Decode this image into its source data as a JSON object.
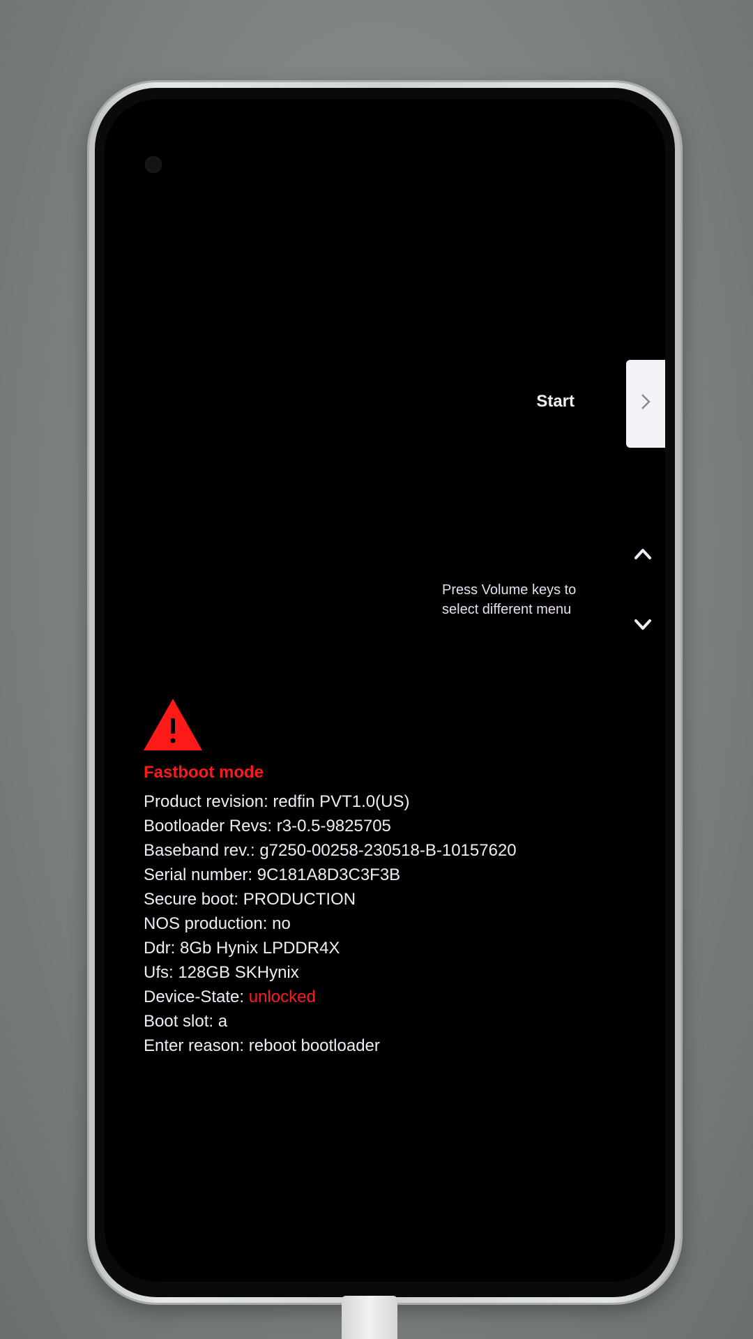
{
  "menu": {
    "start_label": "Start",
    "hint": "Press Volume keys to select different menu"
  },
  "mode": {
    "title": "Fastboot mode",
    "title_color": "#ff1a1a"
  },
  "info": {
    "product_revision": "Product revision: redfin PVT1.0(US)",
    "bootloader_revs": "Bootloader Revs: r3-0.5-9825705",
    "baseband_rev": "Baseband rev.: g7250-00258-230518-B-10157620",
    "serial_number": "Serial number: 9C181A8D3C3F3B",
    "secure_boot": "Secure boot: PRODUCTION",
    "nos_production": "NOS production: no",
    "ddr": "Ddr: 8Gb Hynix LPDDR4X",
    "ufs": "Ufs: 128GB SKHynix",
    "device_state_label": "Device-State: ",
    "device_state_value": "unlocked",
    "boot_slot": "Boot slot: a",
    "enter_reason": "Enter reason: reboot bootloader"
  },
  "icons": {
    "warning": "warning-triangle-icon",
    "start_arrow": "chevron-right-icon",
    "volume_up": "chevron-up-icon",
    "volume_down": "chevron-down-icon"
  }
}
